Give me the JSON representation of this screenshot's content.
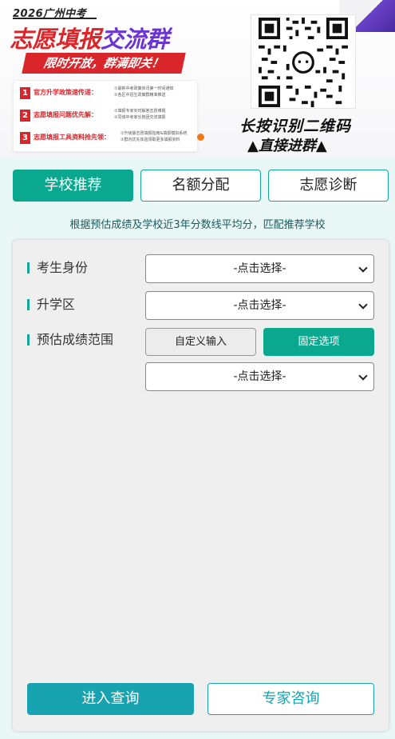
{
  "banner": {
    "year_label": "2026广州中考",
    "title_red": "志愿填报",
    "title_purple": "交流群",
    "ribbon": "限时开放，群满即关！",
    "items": [
      {
        "num": "1",
        "label": "官方升学政策速传递：",
        "desc1": "①最新中考政策资讯第一时间通知",
        "desc2": "②各区中招生政策群精准推送"
      },
      {
        "num": "2",
        "label": "志愿填报问题优先解：",
        "desc1": "①填报专家实时解答志愿难题",
        "desc2": "②同城中考家长抱团交流填报"
      },
      {
        "num": "3",
        "label": "志愿填报工具资料抢先领：",
        "desc1": "①升级版志愿填报指南&填报模拟系统",
        "desc2": "②群内优先体验领取更多填报资料"
      }
    ],
    "qr_caption1": "长按识别二维码",
    "qr_caption2": "▲直接进群▲"
  },
  "tabs": [
    {
      "label": "学校推荐",
      "active": true
    },
    {
      "label": "名额分配",
      "active": false
    },
    {
      "label": "志愿诊断",
      "active": false
    }
  ],
  "hint": "根据预估成绩及学校近3年分数线平均分，匹配推荐学校",
  "form": {
    "identity_label": "考生身份",
    "identity_value": "-点击选择-",
    "district_label": "升学区",
    "district_value": "-点击选择-",
    "score_label": "预估成绩范围",
    "custom_input_label": "自定义输入",
    "fixed_option_label": "固定选项",
    "score_value": "-点击选择-"
  },
  "actions": {
    "query_label": "进入查询",
    "expert_label": "专家咨询"
  },
  "colors": {
    "accent": "#0aa88f",
    "query_button": "#18a3b0",
    "banner_red": "#d9262b",
    "banner_purple": "#6a35d0"
  }
}
